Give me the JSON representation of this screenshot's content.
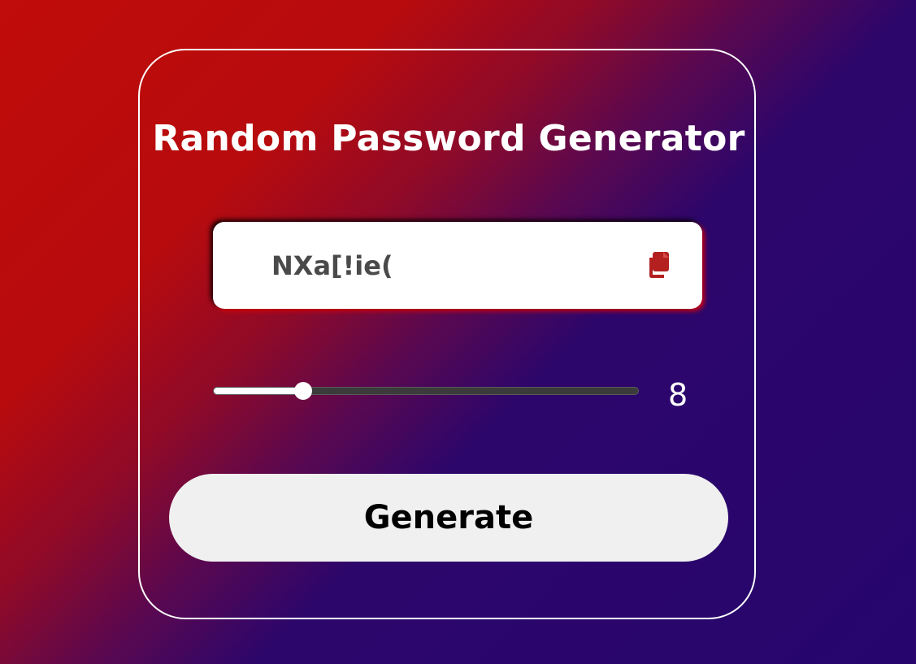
{
  "title": "Random Password Generator",
  "password": {
    "value": "NXa[!ie(",
    "copy_icon": "copy-icon",
    "icon_color": "#b3201f"
  },
  "length": {
    "value": "8",
    "fraction": 0.212
  },
  "generate_label": "Generate",
  "colors": {
    "background_start": "#c00c0a",
    "background_end": "#26066d",
    "button_bg": "#f0f0f0",
    "password_text": "#4a4a4a"
  }
}
